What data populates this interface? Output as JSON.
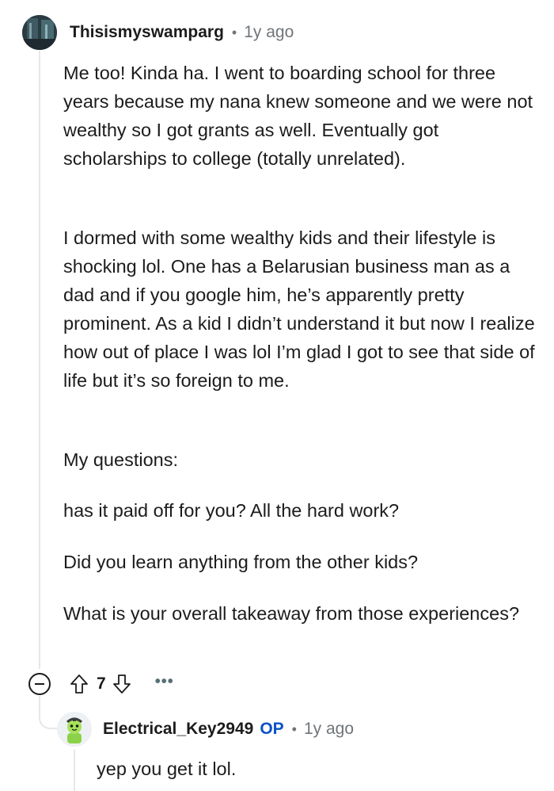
{
  "comment": {
    "author": "Thisismyswamparg",
    "separator": "•",
    "timestamp": "1y ago",
    "paragraphs": [
      "Me too! Kinda ha. I went to boarding school for three years because my nana knew someone and we were not wealthy so I got grants as well. Eventually got scholarships to college (totally unrelated).",
      "I dormed with some wealthy kids and their lifestyle is shocking lol. One has a Belarusian business man as a dad and if you google him, he’s apparently pretty prominent. As a kid I didn’t understand it but now I realize how out of place I was lol I’m glad I got to see that side of life but it’s so foreign to me.",
      "My questions:",
      "has it paid off for you? All the hard work?",
      "Did you learn anything from the other kids?",
      "What is your overall takeaway from those experiences?"
    ],
    "actions": {
      "score": "7",
      "more": "•••"
    }
  },
  "reply": {
    "author": "Electrical_Key2949",
    "op_badge": "OP",
    "separator": "•",
    "timestamp": "1y ago",
    "text": "yep you get it lol."
  },
  "icons": {
    "collapse": "minus-circle-icon",
    "upvote": "arrow-up-outline-icon",
    "downvote": "arrow-down-outline-icon",
    "more": "ellipsis-icon"
  },
  "colors": {
    "op_badge": "#0a52c7",
    "meta_text": "#6f7579",
    "thread_line": "#e5e7e9"
  }
}
